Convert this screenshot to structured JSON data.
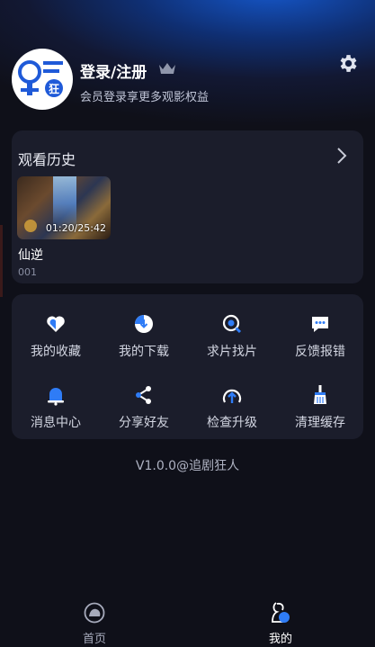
{
  "profile": {
    "avatar_logo_text": "狂",
    "login_title": "登录/注册",
    "subtitle": "会员登录享更多观影权益"
  },
  "history": {
    "title": "观看历史",
    "items": [
      {
        "title": "仙逆",
        "episode": "001",
        "progress": "01:20/25:42"
      }
    ]
  },
  "menu": {
    "items": [
      {
        "label": "我的收藏",
        "icon": "heart-icon"
      },
      {
        "label": "我的下载",
        "icon": "download-icon"
      },
      {
        "label": "求片找片",
        "icon": "search-film-icon"
      },
      {
        "label": "反馈报错",
        "icon": "feedback-icon"
      },
      {
        "label": "消息中心",
        "icon": "bell-icon"
      },
      {
        "label": "分享好友",
        "icon": "share-icon"
      },
      {
        "label": "检查升级",
        "icon": "upgrade-icon"
      },
      {
        "label": "清理缓存",
        "icon": "broom-icon"
      }
    ]
  },
  "version": "V1.0.0@追剧狂人",
  "nav": {
    "items": [
      {
        "label": "首页",
        "icon": "home-icon",
        "active": false
      },
      {
        "label": "我的",
        "icon": "profile-icon",
        "active": true
      }
    ]
  },
  "colors": {
    "accent": "#2f7cf6",
    "background": "#0f1019",
    "card": "#1b1d2b"
  }
}
